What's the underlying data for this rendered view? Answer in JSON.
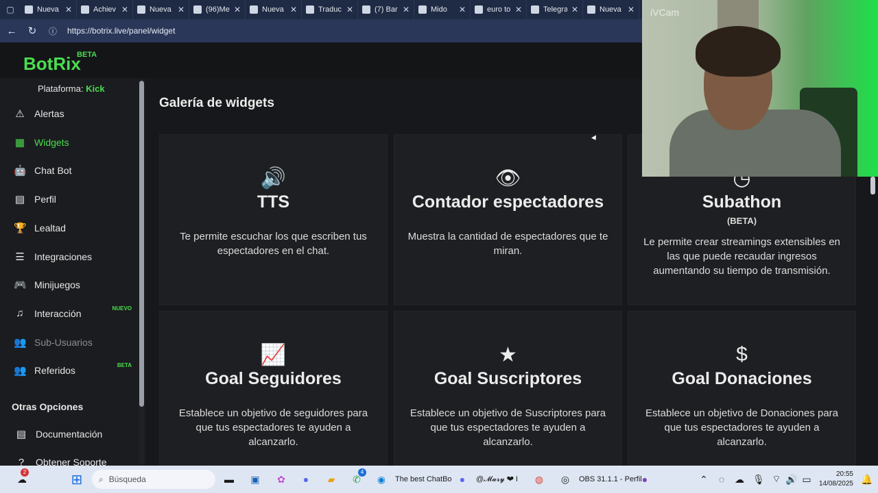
{
  "browser": {
    "tabs": [
      {
        "label": "Nueva",
        "icon": "page-icon"
      },
      {
        "label": "Achiev",
        "icon": "kick-icon"
      },
      {
        "label": "Nueva",
        "icon": "page-icon"
      },
      {
        "label": "(96)Me",
        "icon": "tiktok-icon"
      },
      {
        "label": "Nueva",
        "icon": "page-icon"
      },
      {
        "label": "Traduc",
        "icon": "translate-icon"
      },
      {
        "label": "(7) Bar",
        "icon": "instagram-icon"
      },
      {
        "label": "Mido",
        "icon": "tiktok-icon"
      },
      {
        "label": "euro to",
        "icon": "search-icon"
      },
      {
        "label": "Telegra",
        "icon": "telegram-icon"
      },
      {
        "label": "Nueva",
        "icon": "page-icon"
      }
    ],
    "url": "https://botrix.live/panel/widget"
  },
  "app": {
    "logo": "BotRix",
    "logo_badge": "BETA",
    "platform_label": "Plataforma:",
    "platform_value": "Kick"
  },
  "sidebar": {
    "items": [
      {
        "label": "Alertas",
        "icon": "warning-icon",
        "active": false
      },
      {
        "label": "Widgets",
        "icon": "grid-icon",
        "active": true
      },
      {
        "label": "Chat Bot",
        "icon": "robot-icon",
        "active": false
      },
      {
        "label": "Perfil",
        "icon": "id-card-icon",
        "active": false
      },
      {
        "label": "Lealtad",
        "icon": "trophy-icon",
        "active": false
      },
      {
        "label": "Integraciones",
        "icon": "list-icon",
        "active": false
      },
      {
        "label": "Minijuegos",
        "icon": "gamepad-icon",
        "active": false
      },
      {
        "label": "Interacción",
        "icon": "music-icon",
        "active": false,
        "badge": "NUEVO"
      },
      {
        "label": "Sub-Usuarios",
        "icon": "users-icon",
        "active": false,
        "disabled": true
      },
      {
        "label": "Referidos",
        "icon": "user-group-icon",
        "active": false,
        "badge": "BETA"
      }
    ],
    "other_title": "Otras Opciones",
    "other_items": [
      {
        "label": "Documentación",
        "icon": "book-icon"
      },
      {
        "label": "Obtener Soporte",
        "icon": "question-icon"
      }
    ]
  },
  "main": {
    "title": "Galería de widgets",
    "cards": [
      {
        "title": "TTS",
        "icon": "volume-icon",
        "subtitle": "",
        "description": "Te permite escuchar los que escriben tus espectadores en el chat."
      },
      {
        "title": "Contador espectadores",
        "icon": "eye-icon",
        "subtitle": "",
        "description": "Muestra la cantidad de espectadores que te miran."
      },
      {
        "title": "Subathon",
        "icon": "clock-icon",
        "subtitle": "(BETA)",
        "description": "Le permite crear streamings extensibles en las que puede recaudar ingresos aumentando su tiempo de transmisión."
      },
      {
        "title": "Goal Seguidores",
        "icon": "chart-line-icon",
        "subtitle": "",
        "description": "Establece un objetivo de seguidores para que tus espectadores te ayuden a alcanzarlo."
      },
      {
        "title": "Goal Suscriptores",
        "icon": "star-icon",
        "subtitle": "",
        "description": "Establece un objetivo de Suscriptores para que tus espectadores te ayuden a alcanzarlo."
      },
      {
        "title": "Goal Donaciones",
        "icon": "dollar-icon",
        "subtitle": "",
        "description": "Establece un objetivo de Donaciones para que tus espectadores te ayuden a alcanzarlo."
      }
    ]
  },
  "webcam": {
    "label": "iVCam"
  },
  "taskbar": {
    "search_placeholder": "Búsqueda",
    "edge_label": "The best ChatBo",
    "discord_label": "@𝓜𝓪𝓻𝔂 ❤ I",
    "obs_label": "OBS 31.1.1 - Perfil",
    "whatsapp_badge": "4",
    "weather_badge": "2",
    "time": "20:55",
    "date": "14/08/2025"
  }
}
